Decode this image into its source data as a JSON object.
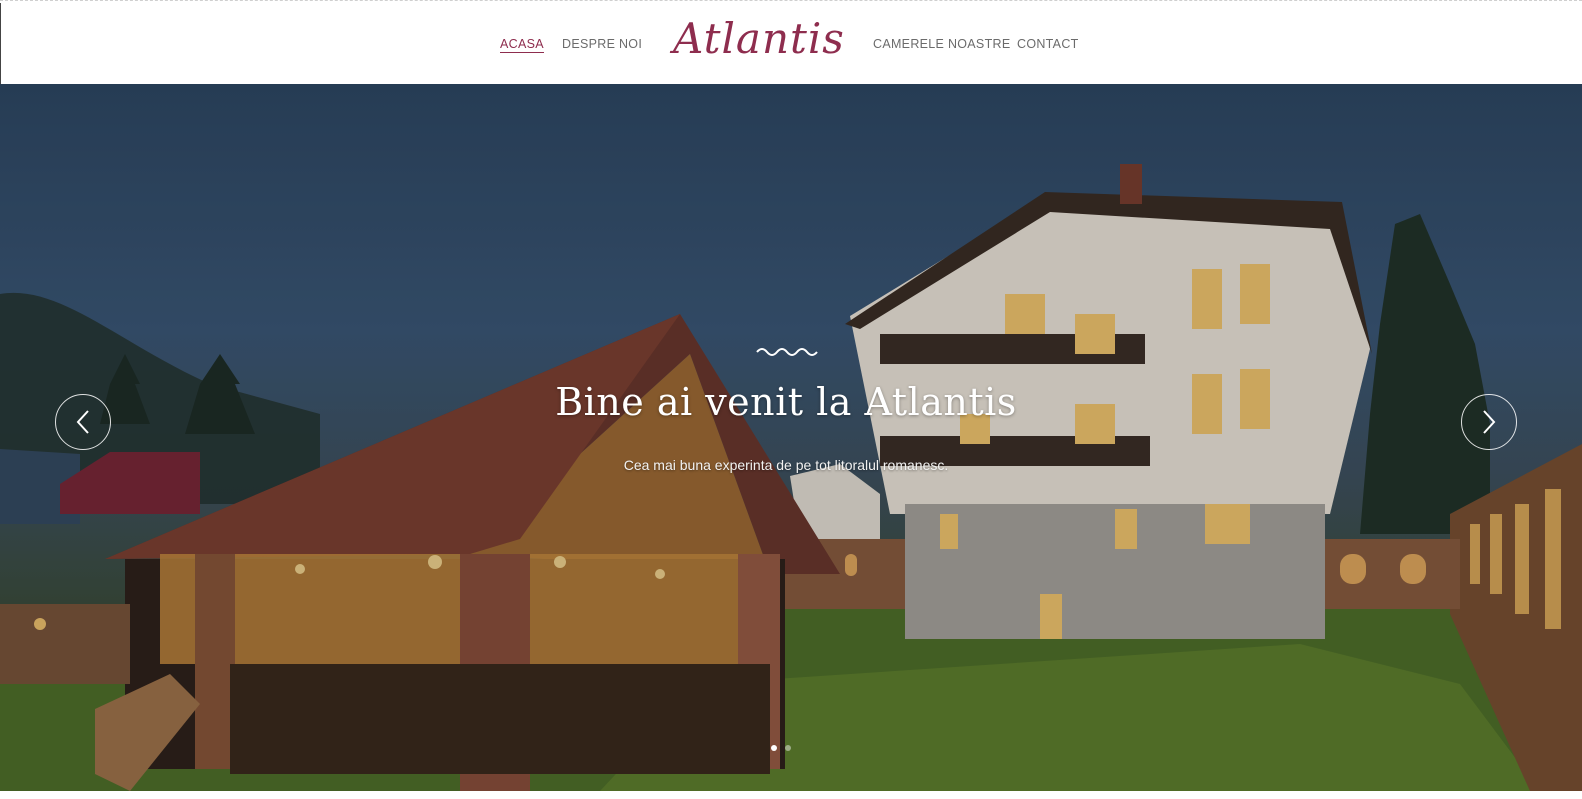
{
  "header": {
    "logo_text": "Atlantis",
    "nav_left": [
      {
        "label": "ACASA",
        "active": true
      },
      {
        "label": "DESPRE NOI",
        "active": false
      }
    ],
    "nav_right": [
      {
        "label": "CAMERELE NOASTRE",
        "active": false
      },
      {
        "label": "CONTACT",
        "active": false
      }
    ]
  },
  "hero": {
    "title": "Bine ai venit la Atlantis",
    "subtitle": "Cea mai buna experinta de pe tot litoralul romanesc.",
    "prev_icon": "chevron-left-icon",
    "next_icon": "chevron-right-icon",
    "slides_count": 2,
    "active_slide": 1
  },
  "colors": {
    "accent": "#8e2d4e",
    "nav_text": "#6b6b6b",
    "hero_text": "#ffffff"
  }
}
